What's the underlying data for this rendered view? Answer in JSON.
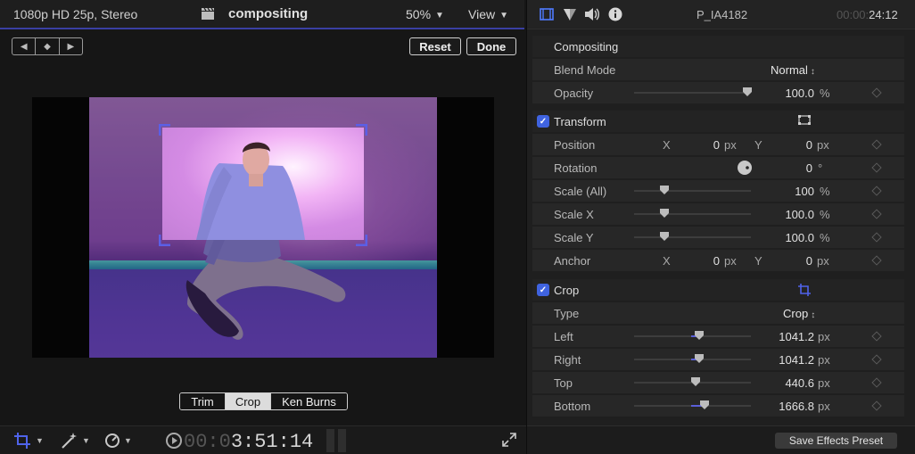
{
  "viewer": {
    "format": "1080p HD 25p, Stereo",
    "project": "compositing",
    "zoom": "50%",
    "view_label": "View",
    "reset_label": "Reset",
    "done_label": "Done",
    "modes": [
      "Trim",
      "Crop",
      "Ken Burns"
    ],
    "active_mode": "Crop",
    "timecode_dim": "00:0",
    "timecode": "3:51:14"
  },
  "inspector": {
    "clip_name": "P_IA4182",
    "duration_dim": "00:00:",
    "duration": "24:12",
    "compositing": {
      "title": "Compositing",
      "blend_mode_label": "Blend Mode",
      "blend_mode_value": "Normal",
      "opacity_label": "Opacity",
      "opacity_value": "100.0",
      "opacity_unit": "%",
      "opacity_fraction": 1.0
    },
    "transform": {
      "title": "Transform",
      "enabled": true,
      "position_label": "Position",
      "position_x": "0",
      "position_y": "0",
      "position_unit": "px",
      "rotation_label": "Rotation",
      "rotation_value": "0",
      "rotation_unit": "°",
      "scale_all_label": "Scale (All)",
      "scale_all_value": "100",
      "scale_all_unit": "%",
      "scale_x_label": "Scale X",
      "scale_x_value": "100.0",
      "scale_x_unit": "%",
      "scale_y_label": "Scale Y",
      "scale_y_value": "100.0",
      "scale_y_unit": "%",
      "anchor_label": "Anchor",
      "anchor_x": "0",
      "anchor_y": "0",
      "anchor_unit": "px",
      "axis_x": "X",
      "axis_y": "Y"
    },
    "crop": {
      "title": "Crop",
      "enabled": true,
      "type_label": "Type",
      "type_value": "Crop",
      "left_label": "Left",
      "left_value": "1041.2",
      "right_label": "Right",
      "right_value": "1041.2",
      "top_label": "Top",
      "top_value": "440.6",
      "bottom_label": "Bottom",
      "bottom_value": "1666.8",
      "unit": "px"
    },
    "save_preset_label": "Save Effects Preset"
  },
  "colors": {
    "accent": "#3f63e0",
    "active_underline": "#3a3fa3",
    "crop_handle": "#5b5fe6"
  },
  "icons": [
    "clapper-icon",
    "keyframe-prev-icon",
    "keyframe-add-icon",
    "keyframe-next-icon",
    "crop-tool-icon",
    "magic-wand-icon",
    "speed-icon",
    "play-icon",
    "fullscreen-icon",
    "video-inspector-icon",
    "color-inspector-icon",
    "audio-inspector-icon",
    "info-inspector-icon",
    "transform-onscreen-icon",
    "crop-onscreen-icon",
    "keyframe-diamond-icon"
  ]
}
